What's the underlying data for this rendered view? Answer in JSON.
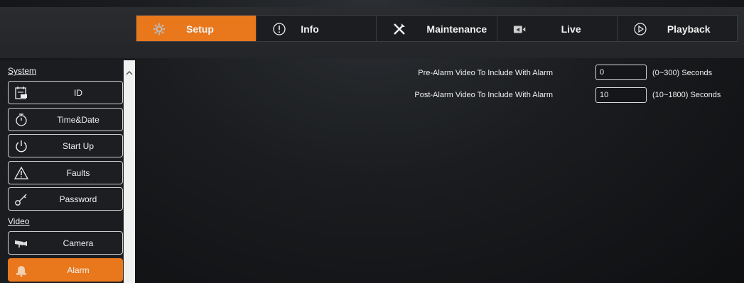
{
  "tabs": [
    {
      "label": "Setup",
      "icon": "gear-icon",
      "active": true
    },
    {
      "label": "Info",
      "icon": "info-icon",
      "active": false
    },
    {
      "label": "Maintenance",
      "icon": "tools-icon",
      "active": false
    },
    {
      "label": "Live",
      "icon": "video-camera-icon",
      "active": false
    },
    {
      "label": "Playback",
      "icon": "play-icon",
      "active": false
    }
  ],
  "sidebar": {
    "sections": [
      {
        "label": "System"
      },
      {
        "label": "Video"
      }
    ],
    "items": [
      {
        "label": "ID",
        "icon": "id-card-icon"
      },
      {
        "label": "Time&Date",
        "icon": "stopwatch-icon"
      },
      {
        "label": "Start Up",
        "icon": "power-icon"
      },
      {
        "label": "Faults",
        "icon": "warning-icon"
      },
      {
        "label": "Password",
        "icon": "key-icon"
      },
      {
        "label": "Camera",
        "icon": "camera-icon"
      },
      {
        "label": "Alarm",
        "icon": "bell-icon",
        "active": true
      }
    ]
  },
  "settings": {
    "pre_alarm": {
      "label": "Pre-Alarm Video To Include With Alarm",
      "value": "0",
      "range": "(0~300) Seconds"
    },
    "post_alarm": {
      "label": "Post-Alarm Video To Include With Alarm",
      "value": "10",
      "range": "(10~1800) Seconds"
    }
  },
  "colors": {
    "accent": "#e9781c",
    "background": "#1a1c1f"
  }
}
